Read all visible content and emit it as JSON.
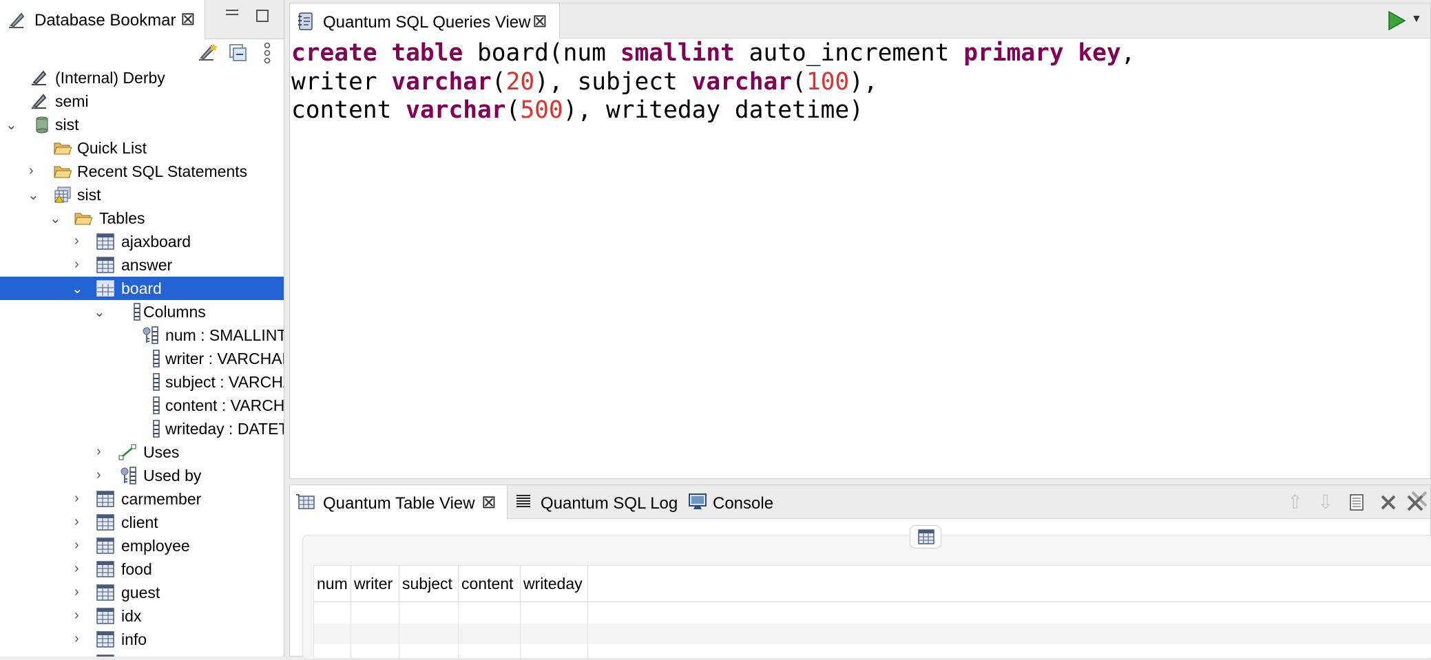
{
  "left_panel": {
    "tab_title": "Database Bookmar",
    "tree": [
      {
        "label": "(Internal) Derby",
        "icon": "bookmark-icon"
      },
      {
        "label": "semi",
        "icon": "bookmark-icon"
      },
      {
        "label": "sist",
        "icon": "database-icon"
      },
      {
        "label": "Quick List",
        "icon": "folder-open-icon"
      },
      {
        "label": "Recent SQL Statements",
        "icon": "folder-icon"
      },
      {
        "label": "sist",
        "icon": "schema-icon"
      },
      {
        "label": "Tables",
        "icon": "folder-open-icon"
      },
      {
        "label": "ajaxboard",
        "icon": "table-icon"
      },
      {
        "label": "answer",
        "icon": "table-icon"
      },
      {
        "label": "board",
        "icon": "table-icon",
        "selected": true
      },
      {
        "label": "Columns",
        "icon": "column-icon"
      },
      {
        "label": "num : SMALLINT",
        "icon": "primary-key-column-icon"
      },
      {
        "label": "writer : VARCHAR",
        "icon": "column-icon"
      },
      {
        "label": "subject : VARCHAR",
        "icon": "column-icon"
      },
      {
        "label": "content : VARCHAR",
        "icon": "column-icon"
      },
      {
        "label": "writeday : DATETIME",
        "icon": "column-icon"
      },
      {
        "label": "Uses",
        "icon": "uses-icon"
      },
      {
        "label": "Used by",
        "icon": "used-by-icon"
      },
      {
        "label": "carmember",
        "icon": "table-icon"
      },
      {
        "label": "client",
        "icon": "table-icon"
      },
      {
        "label": "employee",
        "icon": "table-icon"
      },
      {
        "label": "food",
        "icon": "table-icon"
      },
      {
        "label": "guest",
        "icon": "table-icon"
      },
      {
        "label": "idx",
        "icon": "table-icon"
      },
      {
        "label": "info",
        "icon": "table-icon"
      }
    ]
  },
  "editor": {
    "tab_title": "Quantum SQL Queries View",
    "code": {
      "l1_kw1": "create table",
      "l1_t1": " board(num ",
      "l1_kw2": "smallint",
      "l1_t2": " auto_increment ",
      "l1_kw3": "primary key",
      "l1_t3": ",",
      "l2_t1": "writer ",
      "l2_kw1": "varchar",
      "l2_t2": "(",
      "l2_n1": "20",
      "l2_t3": "), subject ",
      "l2_kw2": "varchar",
      "l2_t4": "(",
      "l2_n2": "100",
      "l2_t5": "),",
      "l3_t1": "content ",
      "l3_kw1": "varchar",
      "l3_t2": "(",
      "l3_n1": "500",
      "l3_t3": "), writeday datetime)"
    }
  },
  "bottom": {
    "tabs": [
      {
        "label": "Quantum Table View",
        "icon": "table-view-icon"
      },
      {
        "label": "Quantum SQL Log",
        "icon": "log-icon"
      },
      {
        "label": "Console",
        "icon": "console-icon"
      }
    ],
    "columns": [
      "num",
      "writer",
      "subject",
      "content",
      "writeday"
    ]
  },
  "colors": {
    "selection": "#2463d3",
    "keyword": "#7f0055",
    "number": "#e03030"
  }
}
